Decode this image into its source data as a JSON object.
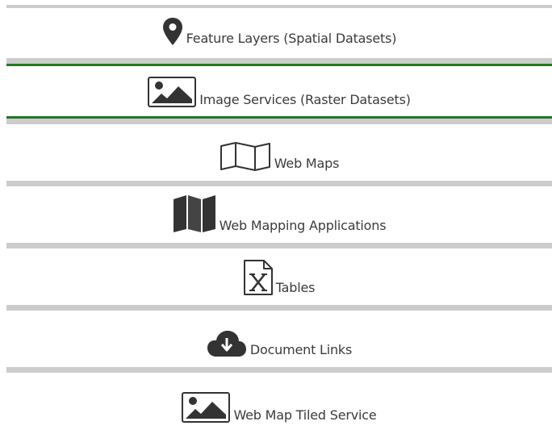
{
  "menu": {
    "items": [
      {
        "label": "Feature Layers (Spatial Datasets)",
        "icon": "map-pin-icon",
        "active": false
      },
      {
        "label": "Image Services (Raster Datasets)",
        "icon": "image-icon",
        "active": true
      },
      {
        "label": "Web Maps",
        "icon": "folded-map-outline-icon",
        "active": false
      },
      {
        "label": "Web Mapping Applications",
        "icon": "folded-map-filled-icon",
        "active": false
      },
      {
        "label": "Tables",
        "icon": "excel-file-icon",
        "active": false
      },
      {
        "label": "Document Links",
        "icon": "cloud-download-icon",
        "active": false
      },
      {
        "label": "Web Map Tiled Service",
        "icon": "image-icon",
        "active": false
      }
    ]
  },
  "colors": {
    "active_border": "#1f7a1f",
    "separator": "#cccccc",
    "icon": "#333333"
  }
}
